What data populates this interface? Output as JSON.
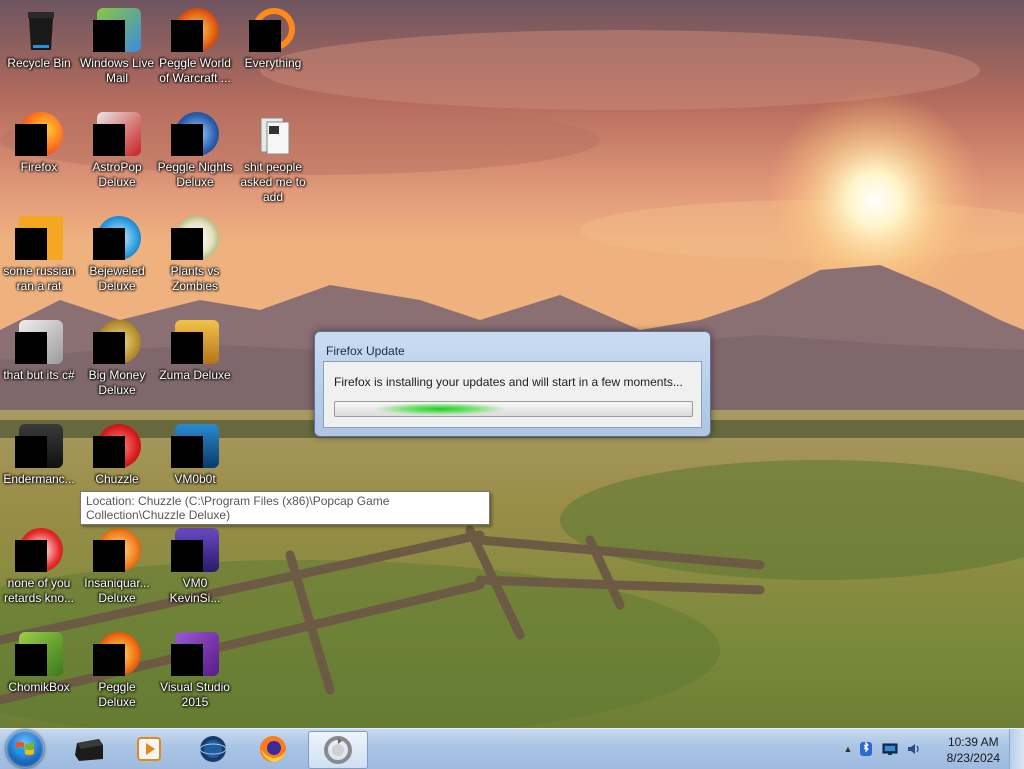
{
  "desktop": {
    "icons": [
      {
        "label": "Recycle Bin",
        "icon": "recycle-bin-icon",
        "masked": false
      },
      {
        "label": "Windows Live Mail",
        "icon": "windows-live-mail-icon",
        "masked": true
      },
      {
        "label": "Peggle World of Warcraft ...",
        "icon": "peggle-wow-icon",
        "masked": true
      },
      {
        "label": "Everything",
        "icon": "everything-search-icon",
        "masked": true
      },
      {
        "label": "Firefox",
        "icon": "firefox-icon",
        "masked": true
      },
      {
        "label": "AstroPop Deluxe",
        "icon": "astropop-icon",
        "masked": true
      },
      {
        "label": "Peggle Nights Deluxe",
        "icon": "peggle-nights-icon",
        "masked": true
      },
      {
        "label": "shit people asked me to add",
        "icon": "folder-icon",
        "masked": false
      },
      {
        "label": "some russian ran a rat",
        "icon": "russian-rat-icon",
        "masked": true
      },
      {
        "label": "Bejeweled Deluxe",
        "icon": "bejeweled-icon",
        "masked": true
      },
      {
        "label": "Plants vs Zombies",
        "icon": "plants-vs-zombies-icon",
        "masked": true
      },
      {
        "label": "that but its c#",
        "icon": "shortcut-stack-icon",
        "masked": true
      },
      {
        "label": "Big Money Deluxe",
        "icon": "big-money-icon",
        "masked": true
      },
      {
        "label": "Zuma Deluxe",
        "icon": "zuma-icon",
        "masked": true
      },
      {
        "label": "Endermanc...",
        "icon": "enderman-icon",
        "masked": true
      },
      {
        "label": "Chuzzle",
        "icon": "chuzzle-icon",
        "masked": true
      },
      {
        "label": "VM0b0t",
        "icon": "vm0b0t-icon",
        "masked": true
      },
      {
        "label": "none of you retards kno...",
        "icon": "shortcut-icon",
        "masked": true
      },
      {
        "label": "Insaniquar... Deluxe",
        "icon": "insaniquarium-icon",
        "masked": true
      },
      {
        "label": "VM0 KevinSi...",
        "icon": "vm0-icon",
        "masked": true
      },
      {
        "label": "ChomikBox",
        "icon": "chomikbox-icon",
        "masked": true
      },
      {
        "label": "Peggle Deluxe",
        "icon": "peggle-icon",
        "masked": true
      },
      {
        "label": "Visual Studio 2015",
        "icon": "visual-studio-icon",
        "masked": true
      }
    ]
  },
  "tooltip": {
    "text": "Location: Chuzzle (C:\\Program Files (x86)\\Popcap Game Collection\\Chuzzle Deluxe)"
  },
  "dialog": {
    "title": "Firefox Update",
    "message": "Firefox is installing your updates and will start in a few moments...",
    "progress_state": "indeterminate"
  },
  "taskbar": {
    "start_icon": "windows-start-orb-icon",
    "pinned": [
      {
        "icon": "terminal-app-icon",
        "active": false
      },
      {
        "icon": "media-player-icon",
        "active": false
      },
      {
        "icon": "globe-app-icon",
        "active": false
      },
      {
        "icon": "firefox-icon",
        "active": false
      },
      {
        "icon": "firefox-update-icon",
        "active": true
      }
    ],
    "tray": {
      "icons": [
        "show-hidden-icons-chevron-icon",
        "bluetooth-icon",
        "network-icon",
        "volume-icon"
      ],
      "chevron_glyph": "▲",
      "time": "10:39 AM",
      "date": "8/23/2024"
    }
  },
  "colors": {
    "dialog_border": "#5d7396",
    "progress_green": "#22c928",
    "taskbar_top": "#c6d9ef",
    "taskbar_bottom": "#9ebadf"
  }
}
